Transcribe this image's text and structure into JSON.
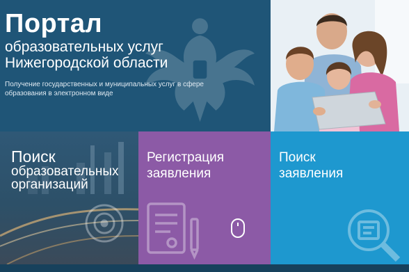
{
  "hero": {
    "title": "Портал",
    "subtitle_line1": "образовательных услуг",
    "subtitle_line2": "Нижегородской области",
    "description": "Получение государственных и муниципальных услуг в сфере образования в электронном виде"
  },
  "tiles": [
    {
      "line1": "Поиск",
      "line2": "образовательных",
      "line3": "организаций",
      "icon": "target-icon",
      "color": "#2f5876"
    },
    {
      "line1": "Регистрация",
      "line2": "заявления",
      "icon": "document-pen-icon",
      "color": "#8c5aa6"
    },
    {
      "line1": "Поиск",
      "line2": "заявления",
      "icon": "magnifier-document-icon",
      "color": "#1e98cf"
    }
  ],
  "colors": {
    "hero_bg": "#1f5577",
    "register_bg": "#8c5aa6",
    "search_app_bg": "#1e98cf",
    "bottom_bar": "#17415c"
  }
}
